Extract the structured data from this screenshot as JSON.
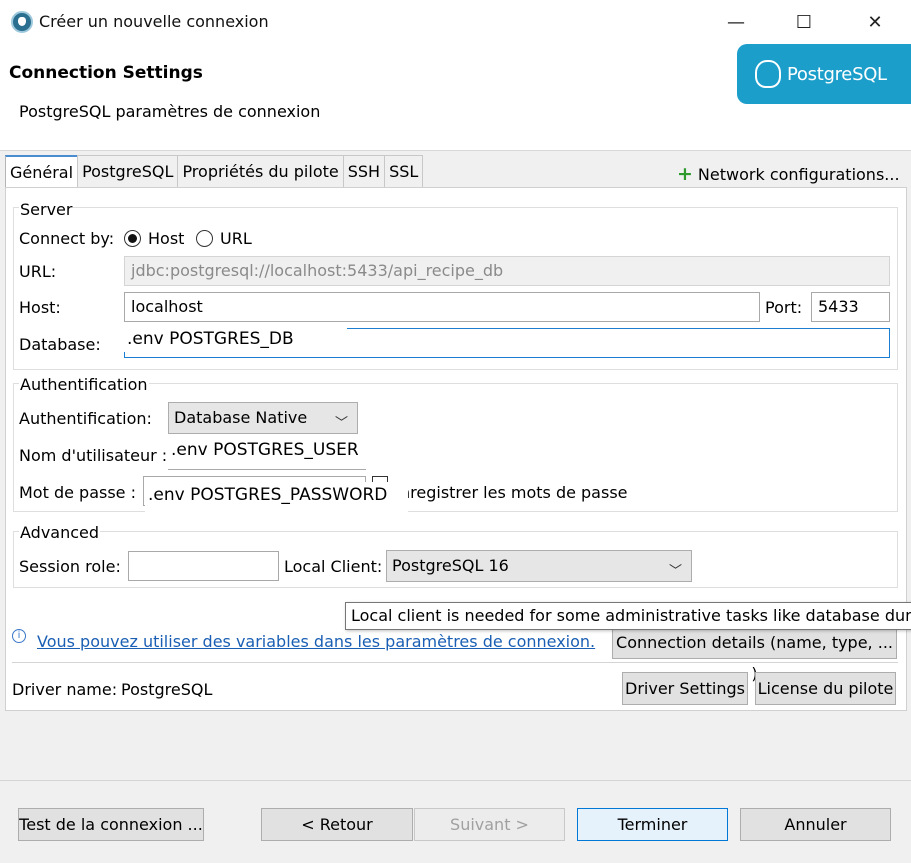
{
  "window": {
    "title": "Créer un nouvelle connexion",
    "minimize_glyph": "—",
    "maximize_glyph": "☐",
    "close_glyph": "✕"
  },
  "header": {
    "title": "Connection Settings",
    "subtitle": "PostgreSQL paramètres de connexion",
    "logo_text": "PostgreSQL"
  },
  "tabs": [
    {
      "label": "Général"
    },
    {
      "label": "PostgreSQL"
    },
    {
      "label": "Propriétés du pilote"
    },
    {
      "label": "SSH"
    },
    {
      "label": "SSL"
    }
  ],
  "network_config": {
    "icon": "+",
    "label": "Network configurations..."
  },
  "server": {
    "group_label": "Server",
    "connect_by_label": "Connect by:",
    "host_option": "Host",
    "url_option": "URL",
    "url_label": "URL:",
    "url_value": "jdbc:postgresql://localhost:5433/api_recipe_db",
    "host_label": "Host:",
    "host_value": "localhost",
    "port_label": "Port:",
    "port_value": "5433",
    "database_label": "Database:",
    "database_value": ".env POSTGRES_DB"
  },
  "auth": {
    "group_label": "Authentification",
    "auth_label": "Authentification:",
    "auth_value": "Database Native",
    "user_label": "Nom d'utilisateur :",
    "user_value": ".env POSTGRES_USER",
    "password_label": "Mot de passe :",
    "password_value": ".env POSTGRES_PASSWORD",
    "save_passwords_label": "nregistrer les mots de passe"
  },
  "advanced": {
    "group_label": "Advanced",
    "session_role_label": "Session role:",
    "session_role_value": "",
    "local_client_label": "Local Client:",
    "local_client_value": "PostgreSQL 16"
  },
  "tooltip": "Local client is needed for some administrative tasks like database dump",
  "info": {
    "icon": "i",
    "link": "Vous pouvez utiliser des variables dans les paramètres de connexion.",
    "details_button": "Connection details (name, type, ... )"
  },
  "driver": {
    "label": "Driver name:",
    "name": "PostgreSQL",
    "settings_button": "Driver Settings",
    "license_button": "License du pilote"
  },
  "footer": {
    "test_button": "Test de la connexion ...",
    "back_button": "< Retour",
    "next_button": "Suivant >",
    "finish_button": "Terminer",
    "cancel_button": "Annuler"
  }
}
